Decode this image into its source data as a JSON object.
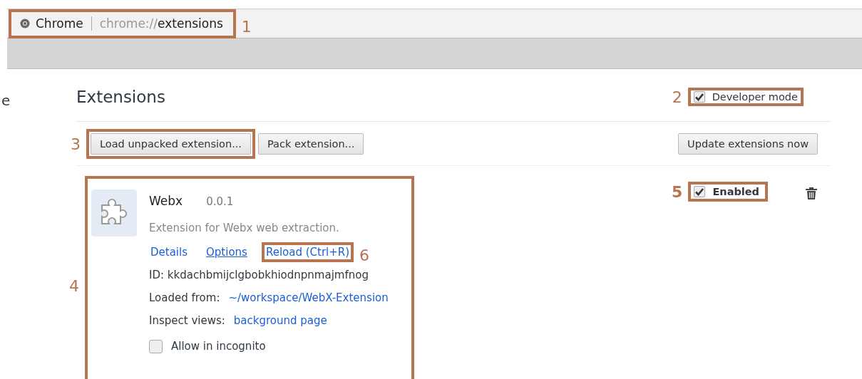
{
  "omnibox": {
    "site_label": "Chrome",
    "url_scheme": "chrome://",
    "url_path": "extensions",
    "callout": {
      "number": "1"
    }
  },
  "sidebar_fragment": "e",
  "page": {
    "title": "Extensions",
    "developer_mode": {
      "label": "Developer mode",
      "checked": true,
      "callout": {
        "number": "2"
      }
    },
    "buttons": [
      {
        "label": "Load unpacked extension...",
        "callout": {
          "number": "3"
        }
      },
      {
        "label": "Pack extension..."
      }
    ],
    "update_button": {
      "label": "Update extensions now"
    }
  },
  "extension": {
    "name": "Webx",
    "version": "0.0.1",
    "description": "Extension for Webx web extraction.",
    "links": [
      {
        "label": "Details",
        "underlined": false
      },
      {
        "label": "Options",
        "underlined": true
      },
      {
        "label": "Reload (Ctrl+R)",
        "underlined": false,
        "callout": {
          "number": "6"
        }
      }
    ],
    "id_line": "ID: kkdachbmijclgbobkhiodnpnmajmfnog",
    "loaded_from": {
      "label": "Loaded from:",
      "link": "~/workspace/WebX-Extension"
    },
    "inspect_views": {
      "label": "Inspect views:",
      "link": "background page"
    },
    "allow_incognito": {
      "label": "Allow in incognito",
      "checked": false
    },
    "enabled": {
      "label": "Enabled",
      "checked": true,
      "callout": {
        "number": "5"
      }
    },
    "callout": {
      "number": "4"
    }
  }
}
